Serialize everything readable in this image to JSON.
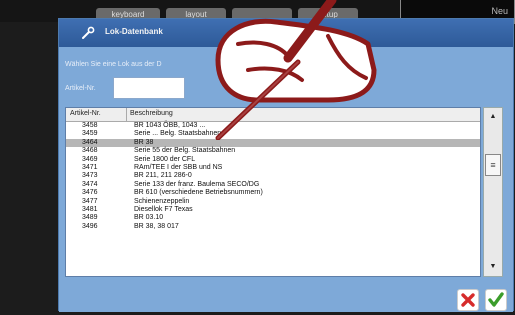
{
  "background": {
    "buttons": [
      "keyboard",
      "layout",
      "",
      "setup"
    ],
    "panel_text": "Neu"
  },
  "dialog": {
    "title": "Lok-Datenbank",
    "instruction": "Wählen Sie eine Lok aus der D",
    "search_label": "Artikel-Nr.",
    "search_value": "",
    "columns": [
      "Artikel-Nr.",
      "Beschreibung"
    ],
    "rows": [
      {
        "art": "3458",
        "desc": "BR 1043 ÖBB, 1043 ... "
      },
      {
        "art": "3459",
        "desc": "Serie ... Belg. Staatsbahnen"
      },
      {
        "art": "3464",
        "desc": "BR 38",
        "selected": true
      },
      {
        "art": "3468",
        "desc": "Serie 55 der Belg. Staatsbahnen"
      },
      {
        "art": "3469",
        "desc": "Serie 1800 der CFL"
      },
      {
        "art": "3471",
        "desc": "RAm/TEE I der SBB und NS"
      },
      {
        "art": "3473",
        "desc": "BR 211, 211 286-0"
      },
      {
        "art": "3474",
        "desc": "Serie 133 der franz. Baulema SECO/DG"
      },
      {
        "art": "3476",
        "desc": "BR 610 (verschiedene Betriebsnummern)"
      },
      {
        "art": "3477",
        "desc": "Schienenzeppelin"
      },
      {
        "art": "3481",
        "desc": "Diesellok F7 Texas"
      },
      {
        "art": "3489",
        "desc": "BR 03.10"
      },
      {
        "art": "3496",
        "desc": "BR 38, 38 017"
      }
    ],
    "colors": {
      "accent": "#2e5a98",
      "dialog_bg": "#7ea9d8",
      "selected_row": "#b6b6b6",
      "cancel": "#d62b2b",
      "ok": "#3b9d2b"
    }
  },
  "icons": [
    "wrench-icon",
    "scroll-up-icon",
    "scroll-thumb-icon",
    "scroll-down-icon",
    "cancel-x-icon",
    "ok-check-icon",
    "hand-pencil-overlay"
  ]
}
